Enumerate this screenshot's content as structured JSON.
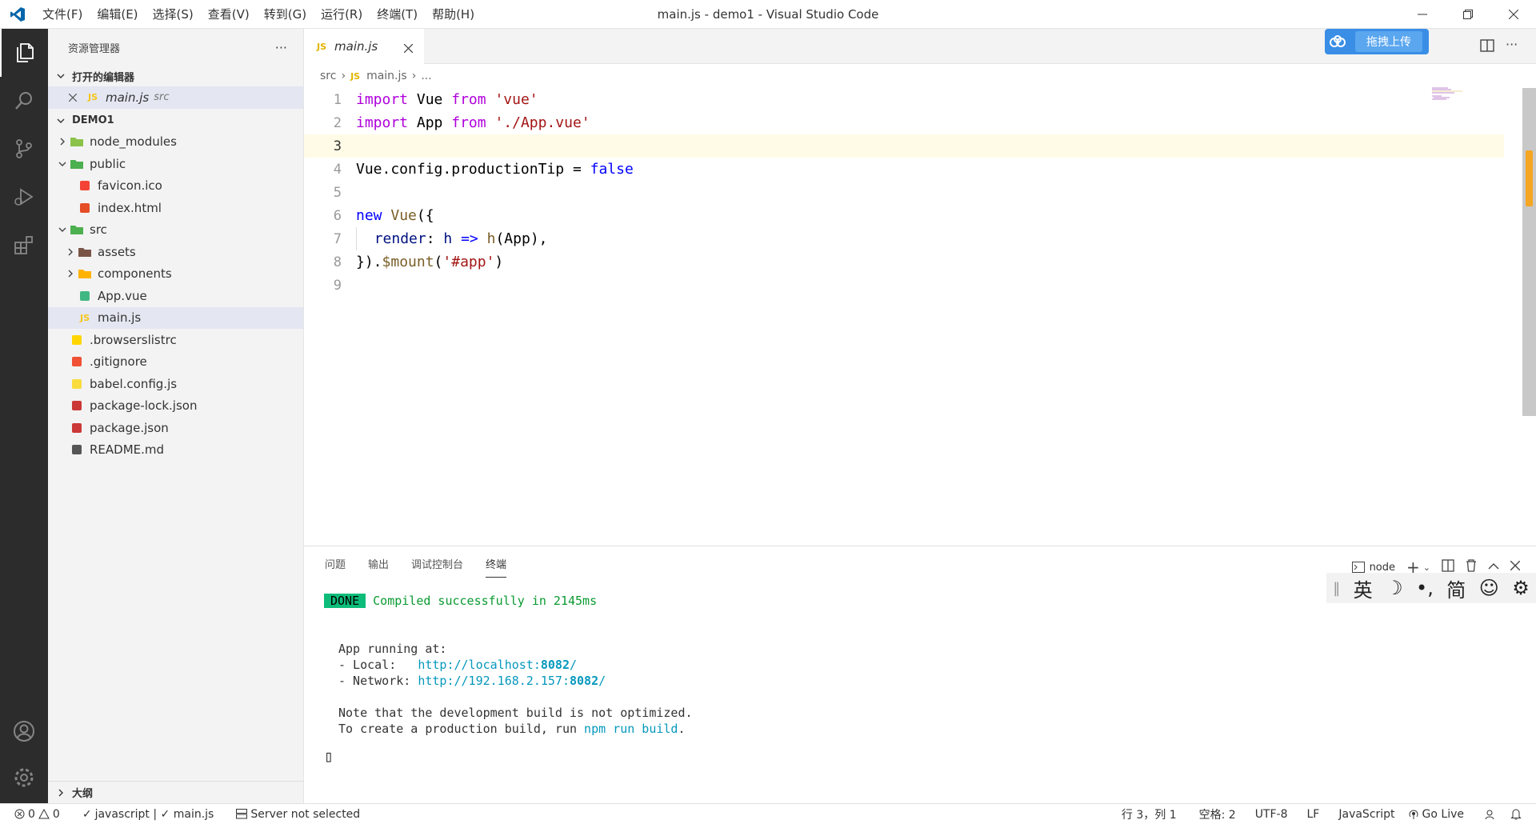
{
  "window": {
    "title": "main.js - demo1 - Visual Studio Code"
  },
  "menu": [
    "文件(F)",
    "编辑(E)",
    "选择(S)",
    "查看(V)",
    "转到(G)",
    "运行(R)",
    "终端(T)",
    "帮助(H)"
  ],
  "sidebar": {
    "title": "资源管理器",
    "more": "···",
    "open_editors_label": "打开的编辑器",
    "open_editor": {
      "name": "main.js",
      "folder": "src"
    },
    "project": "DEMO1",
    "tree": [
      {
        "name": "node_modules",
        "depth": 0,
        "icon": "node-modules-folder-icon",
        "color": "#8bc34a"
      },
      {
        "name": "public",
        "depth": 0,
        "icon": "public-folder-icon",
        "color": "#4caf50"
      },
      {
        "name": "favicon.ico",
        "depth": 1,
        "icon": "favicon-icon",
        "color": "#f44336"
      },
      {
        "name": "index.html",
        "depth": 1,
        "icon": "html-icon",
        "color": "#e44d26"
      },
      {
        "name": "src",
        "depth": 0,
        "icon": "src-folder-icon",
        "color": "#4caf50"
      },
      {
        "name": "assets",
        "depth": 1,
        "icon": "assets-folder-icon",
        "color": "#795548"
      },
      {
        "name": "components",
        "depth": 1,
        "icon": "components-folder-icon",
        "color": "#ffb300"
      },
      {
        "name": "App.vue",
        "depth": 1,
        "icon": "vue-icon",
        "color": "#41b883"
      },
      {
        "name": "main.js",
        "depth": 1,
        "icon": "js-icon",
        "color": "#f5c518"
      },
      {
        "name": ".browserslistrc",
        "depth": 0,
        "icon": "browserslist-icon",
        "color": "#ffd600"
      },
      {
        "name": ".gitignore",
        "depth": 0,
        "icon": "git-icon",
        "color": "#f05033"
      },
      {
        "name": "babel.config.js",
        "depth": 0,
        "icon": "babel-icon",
        "color": "#f9dc3e"
      },
      {
        "name": "package-lock.json",
        "depth": 0,
        "icon": "npm-icon",
        "color": "#cb3837"
      },
      {
        "name": "package.json",
        "depth": 0,
        "icon": "npm-icon",
        "color": "#cb3837"
      },
      {
        "name": "README.md",
        "depth": 0,
        "icon": "markdown-icon",
        "color": "#555555"
      }
    ],
    "outline_label": "大纲"
  },
  "editor": {
    "tab": {
      "lang_badge": "JS",
      "name": "main.js"
    },
    "upload_button": "拖拽上传",
    "breadcrumb": [
      "src",
      "JS",
      "main.js",
      "..."
    ],
    "lines": [
      "1",
      "2",
      "3",
      "4",
      "5",
      "6",
      "7",
      "8",
      "9"
    ]
  },
  "panel": {
    "tabs": [
      "问题",
      "输出",
      "调试控制台",
      "终端"
    ],
    "terminal_name": "node",
    "ime": [
      "英",
      "☽",
      "•,",
      "简",
      "☺",
      "⚙"
    ],
    "output": {
      "done": "DONE",
      "compiled": "Compiled successfully in 2145ms",
      "running": "App running at:",
      "local_label": "- Local:   ",
      "local_url": "http://localhost:",
      "local_port": "8082",
      "network_label": "- Network: ",
      "network_url": "http://192.168.2.157:",
      "network_port": "8082",
      "note": "Note that the development build is not optimized.",
      "prod_prefix": "To create a production build, run ",
      "prod_cmd": "npm run build",
      "cursor": "▯"
    }
  },
  "status": {
    "errors": "0",
    "warnings": "0",
    "lint": "javascript | ✓ main.js",
    "server": "Server not selected",
    "position": "行 3，列 1",
    "spaces": "空格: 2",
    "encoding": "UTF-8",
    "eol": "LF",
    "language": "JavaScript",
    "golive": "Go Live"
  }
}
